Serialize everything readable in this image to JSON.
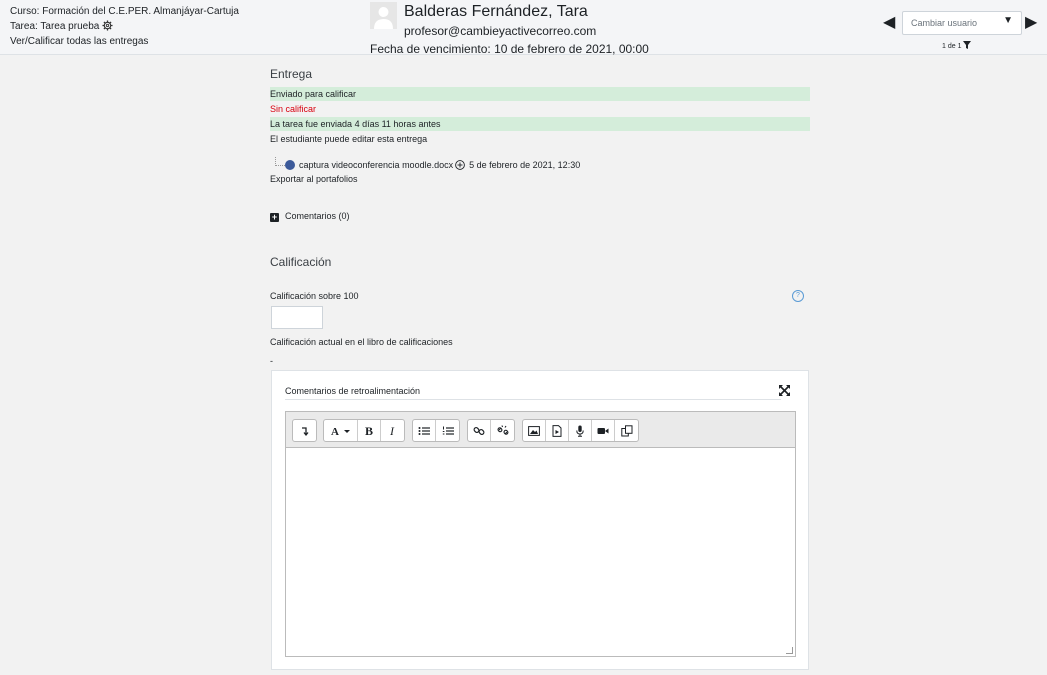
{
  "header": {
    "course": "Curso: Formación del C.E.PER. Almanjáyar-Cartuja",
    "task": "Tarea: Tarea prueba",
    "view_all": "Ver/Calificar todas las entregas",
    "user_name": "Balderas Fernández, Tara",
    "user_email": "profesor@cambieyactivecorreo.com",
    "due_date": "Fecha de vencimiento: 10 de febrero de 2021, 00:00",
    "change_user": "Cambiar usuario",
    "paging": "1 de 1"
  },
  "submission": {
    "title": "Entrega",
    "status": "Enviado para calificar",
    "grading_status": "Sin calificar",
    "time_info": "La tarea fue enviada 4 días 11 horas antes",
    "edit_info": "El estudiante puede editar esta entrega",
    "file_name": "captura videoconferencia moodle.docx",
    "file_date": "5 de febrero de 2021, 12:30",
    "export": "Exportar al portafolios",
    "comments": "Comentarios (0)"
  },
  "grading": {
    "title": "Calificación",
    "grade_label": "Calificación sobre 100",
    "grade_value": "",
    "current_label": "Calificación actual en el libro de calificaciones",
    "current_value": "-",
    "feedback_label": "Comentarios de retroalimentación",
    "feedback_value": ""
  },
  "colors": {
    "status_green": "#d4edda",
    "not_graded_red": "#d9000f",
    "help_blue": "#5b9bd5"
  }
}
